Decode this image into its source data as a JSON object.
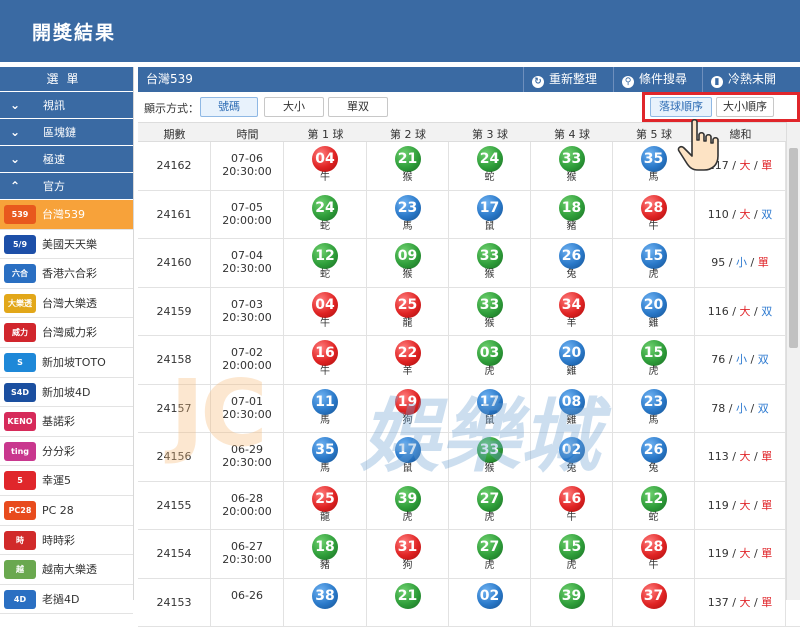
{
  "header": {
    "title": "開獎結果"
  },
  "sidebar": {
    "menu_title": "選單",
    "categories": [
      {
        "label": "視訊",
        "chev": "⌄"
      },
      {
        "label": "區塊鏈",
        "chev": "⌄"
      },
      {
        "label": "極速",
        "chev": "⌄"
      },
      {
        "label": "官方",
        "chev": "⌃"
      }
    ],
    "items": [
      {
        "label": "台灣539",
        "logo": "539",
        "color": "#e8581d",
        "active": true
      },
      {
        "label": "美國天天樂",
        "logo": "5/9",
        "color": "#1d4fa8"
      },
      {
        "label": "香港六合彩",
        "logo": "六合",
        "color": "#2a6fc2"
      },
      {
        "label": "台灣大樂透",
        "logo": "大樂透",
        "color": "#e2a719"
      },
      {
        "label": "台灣威力彩",
        "logo": "威力",
        "color": "#d1262d"
      },
      {
        "label": "新加坡TOTO",
        "logo": "S",
        "color": "#1e88d8"
      },
      {
        "label": "新加坡4D",
        "logo": "S4D",
        "color": "#1b4fa0"
      },
      {
        "label": "基諾彩",
        "logo": "KENO",
        "color": "#d62a5a"
      },
      {
        "label": "分分彩",
        "logo": "ting",
        "color": "#c9378e"
      },
      {
        "label": "幸運5",
        "logo": "5",
        "color": "#e0262b"
      },
      {
        "label": "PC 28",
        "logo": "PC28",
        "color": "#e84b1d"
      },
      {
        "label": "時時彩",
        "logo": "時",
        "color": "#d12a2a"
      },
      {
        "label": "越南大樂透",
        "logo": "越",
        "color": "#6aa84f"
      },
      {
        "label": "老撾4D",
        "logo": "4D",
        "color": "#2a6fc2"
      }
    ]
  },
  "topbar": {
    "lottery_name": "台灣539",
    "refresh_label": "重新整理",
    "search_label": "條件搜尋",
    "hotcold_label": "冷熱未開"
  },
  "options": {
    "display_mode_label": "顯示方式：",
    "mode_buttons": [
      "號碼",
      "大小",
      "單双"
    ],
    "order_buttons": [
      "落球順序",
      "大小順序"
    ]
  },
  "table": {
    "headers": [
      "期數",
      "時間",
      "第 1 球",
      "第 2 球",
      "第 3 球",
      "第 4 球",
      "第 5 球",
      "總和"
    ],
    "rows": [
      {
        "issue": "24162",
        "date": "07-06",
        "time": "20:30:00",
        "balls": [
          [
            "04",
            "red",
            "牛"
          ],
          [
            "21",
            "green",
            "猴"
          ],
          [
            "24",
            "green",
            "蛇"
          ],
          [
            "33",
            "green",
            "猴"
          ],
          [
            "35",
            "blue",
            "馬"
          ]
        ],
        "sum": "117",
        "size": "大",
        "parity": "單"
      },
      {
        "issue": "24161",
        "date": "07-05",
        "time": "20:00:00",
        "balls": [
          [
            "24",
            "green",
            "蛇"
          ],
          [
            "23",
            "blue",
            "馬"
          ],
          [
            "17",
            "blue",
            "鼠"
          ],
          [
            "18",
            "green",
            "豬"
          ],
          [
            "28",
            "red",
            "牛"
          ]
        ],
        "sum": "110",
        "size": "大",
        "parity": "双"
      },
      {
        "issue": "24160",
        "date": "07-04",
        "time": "20:30:00",
        "balls": [
          [
            "12",
            "green",
            "蛇"
          ],
          [
            "09",
            "green",
            "猴"
          ],
          [
            "33",
            "green",
            "猴"
          ],
          [
            "26",
            "blue",
            "兔"
          ],
          [
            "15",
            "blue",
            "虎"
          ]
        ],
        "sum": "95",
        "size": "小",
        "parity": "單"
      },
      {
        "issue": "24159",
        "date": "07-03",
        "time": "20:30:00",
        "balls": [
          [
            "04",
            "red",
            "牛"
          ],
          [
            "25",
            "red",
            "龍"
          ],
          [
            "33",
            "green",
            "猴"
          ],
          [
            "34",
            "red",
            "羊"
          ],
          [
            "20",
            "blue",
            "雞"
          ]
        ],
        "sum": "116",
        "size": "大",
        "parity": "双"
      },
      {
        "issue": "24158",
        "date": "07-02",
        "time": "20:00:00",
        "balls": [
          [
            "16",
            "red",
            "牛"
          ],
          [
            "22",
            "red",
            "羊"
          ],
          [
            "03",
            "green",
            "虎"
          ],
          [
            "20",
            "blue",
            "雞"
          ],
          [
            "15",
            "green",
            "虎"
          ]
        ],
        "sum": "76",
        "size": "小",
        "parity": "双"
      },
      {
        "issue": "24157",
        "date": "07-01",
        "time": "20:30:00",
        "balls": [
          [
            "11",
            "blue",
            "馬"
          ],
          [
            "19",
            "red",
            "狗"
          ],
          [
            "17",
            "blue",
            "鼠"
          ],
          [
            "08",
            "blue",
            "雞"
          ],
          [
            "23",
            "blue",
            "馬"
          ]
        ],
        "sum": "78",
        "size": "小",
        "parity": "双"
      },
      {
        "issue": "24156",
        "date": "06-29",
        "time": "20:30:00",
        "balls": [
          [
            "35",
            "blue",
            "馬"
          ],
          [
            "17",
            "blue",
            "鼠"
          ],
          [
            "33",
            "green",
            "猴"
          ],
          [
            "02",
            "blue",
            "兔"
          ],
          [
            "26",
            "blue",
            "兔"
          ]
        ],
        "sum": "113",
        "size": "大",
        "parity": "單"
      },
      {
        "issue": "24155",
        "date": "06-28",
        "time": "20:00:00",
        "balls": [
          [
            "25",
            "red",
            "龍"
          ],
          [
            "39",
            "green",
            "虎"
          ],
          [
            "27",
            "green",
            "虎"
          ],
          [
            "16",
            "red",
            "牛"
          ],
          [
            "12",
            "green",
            "蛇"
          ]
        ],
        "sum": "119",
        "size": "大",
        "parity": "單"
      },
      {
        "issue": "24154",
        "date": "06-27",
        "time": "20:30:00",
        "balls": [
          [
            "18",
            "green",
            "豬"
          ],
          [
            "31",
            "red",
            "狗"
          ],
          [
            "27",
            "green",
            "虎"
          ],
          [
            "15",
            "green",
            "虎"
          ],
          [
            "28",
            "red",
            "牛"
          ]
        ],
        "sum": "119",
        "size": "大",
        "parity": "單"
      },
      {
        "issue": "24153",
        "date": "06-26",
        "time": "",
        "balls": [
          [
            "38",
            "blue",
            ""
          ],
          [
            "21",
            "green",
            ""
          ],
          [
            "02",
            "blue",
            ""
          ],
          [
            "39",
            "green",
            ""
          ],
          [
            "37",
            "red",
            ""
          ]
        ],
        "sum": "137",
        "size": "大",
        "parity": "單"
      }
    ]
  },
  "watermark": {
    "jc": "JC",
    "text": "娛樂城"
  }
}
